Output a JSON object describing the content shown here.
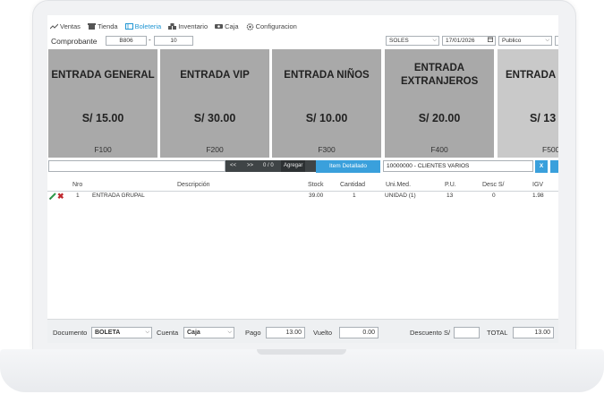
{
  "nav": {
    "items": [
      {
        "label": "Ventas",
        "icon": "chart-line-icon"
      },
      {
        "label": "Tienda",
        "icon": "store-icon"
      },
      {
        "label": "Boleteria",
        "icon": "ticket-icon",
        "active": true
      },
      {
        "label": "Inventario",
        "icon": "boxes-icon"
      },
      {
        "label": "Caja",
        "icon": "cash-icon"
      },
      {
        "label": "Configuracion",
        "icon": "gear-icon"
      }
    ]
  },
  "header": {
    "comprobante_label": "Comprobante",
    "serie": "B806",
    "separator": "-",
    "numero": "10",
    "currency": "SOLES",
    "date": "17/01/2026",
    "price_list": "Publico"
  },
  "cards": [
    {
      "title": "ENTRADA GENERAL",
      "price": "S/ 15.00",
      "code": "F100"
    },
    {
      "title": "ENTRADA VIP",
      "price": "S/ 30.00",
      "code": "F200"
    },
    {
      "title": "ENTRADA NIÑOS",
      "price": "S/ 10.00",
      "code": "F300"
    },
    {
      "title": "ENTRADA EXTRANJEROS",
      "price": "S/ 20.00",
      "code": "F400"
    },
    {
      "title": "ENTRADA",
      "price": "S/ 13",
      "code": "F500"
    }
  ],
  "search": {
    "prev": "<<",
    "next": ">>",
    "page": "0 / 0",
    "add_label": "Agregar",
    "detail_label": "Item Detallado",
    "client": "10000000 - CLIENTES VARIOS",
    "clear_label": "X"
  },
  "table": {
    "headers": [
      "Nro",
      "Descripción",
      "Stock",
      "Cantidad",
      "Uni.Med.",
      "P.U.",
      "Desc S/",
      "IGV"
    ],
    "rows": [
      {
        "nro": "1",
        "descripcion": "ENTRADA GRUPAL",
        "stock": "39.00",
        "cantidad": "1",
        "unimed": "UNIDAD (1)",
        "pu": "13",
        "desc": "0",
        "igv": "1.98"
      }
    ]
  },
  "footer": {
    "documento_label": "Documento",
    "documento": "BOLETA",
    "cuenta_label": "Cuenta",
    "cuenta": "Caja",
    "pago_label": "Pago",
    "pago": "13.00",
    "vuelto_label": "Vuelto",
    "vuelto": "0.00",
    "descuento_label": "Descuento S/",
    "descuento": "",
    "total_label": "TOTAL",
    "total": "13.00"
  },
  "colors": {
    "accent": "#3aa0dc",
    "card": "#a9a9a9",
    "card_partial": "#c9c9c9",
    "delete": "#c0282e",
    "edit": "#2e9a4a"
  }
}
